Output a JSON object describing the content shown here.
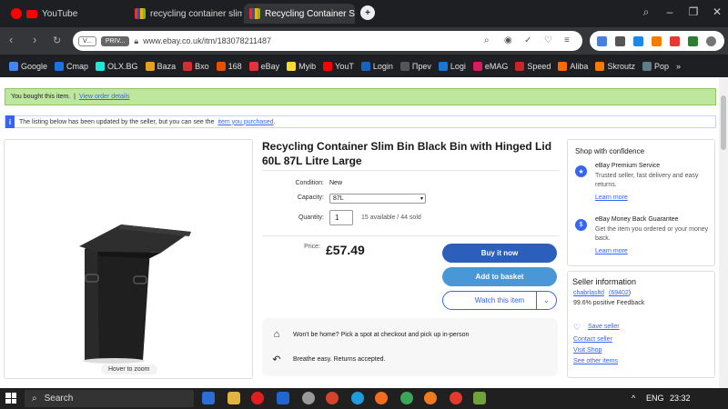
{
  "browser": {
    "tabs": [
      {
        "label": "YouTube",
        "color": "#ff0000"
      },
      {
        "label": "recycling container slim b",
        "color": "#e53238"
      },
      {
        "label": "Recycling Container Slim B",
        "color": "#e53238"
      }
    ],
    "new_tab": "+",
    "address": {
      "badge1": "V...",
      "badge2": "PRIV...",
      "url": "www.ebay.co.uk/itm/183078211487"
    }
  },
  "bookmarks": [
    {
      "label": "Google",
      "color": "#4285f4"
    },
    {
      "label": "Cmap",
      "color": "#1a73e8"
    },
    {
      "label": "OLX.BG",
      "color": "#23e5db"
    },
    {
      "label": "Baza",
      "color": "#e6a020"
    },
    {
      "label": "Bxo",
      "color": "#d32f2f"
    },
    {
      "label": "168",
      "color": "#e65100"
    },
    {
      "label": "eBay",
      "color": "#e53238"
    },
    {
      "label": "Myib",
      "color": "#fdd835"
    },
    {
      "label": "YouT",
      "color": "#ff0000"
    },
    {
      "label": "Login",
      "color": "#1565c0"
    },
    {
      "label": "Преv",
      "color": "#555555"
    },
    {
      "label": "Logi",
      "color": "#1976d2"
    },
    {
      "label": "eMAG",
      "color": "#d81b60"
    },
    {
      "label": "Speed",
      "color": "#c62828"
    },
    {
      "label": "Aliba",
      "color": "#ff6a00"
    },
    {
      "label": "Skroutz",
      "color": "#f57c00"
    },
    {
      "label": "Pop",
      "color": "#607d8b"
    },
    {
      "label": "»",
      "color": ""
    }
  ],
  "notices": {
    "bought": "You bought this item.",
    "sep": "|",
    "view_order": "View order details",
    "updated": "The listing below has been updated by the seller, but you can see the",
    "updated_link": "item you purchased",
    "updated_end": "."
  },
  "listing": {
    "title": "Recycling Container Slim Bin Black Bin with Hinged Lid 60L 87L Litre Large",
    "hover_zoom": "Hover to zoom",
    "condition_label": "Condition:",
    "condition_value": "New",
    "capacity_label": "Capacity:",
    "capacity_value": "87L",
    "quantity_label": "Quantity:",
    "quantity_value": "1",
    "availability": "15 available / 44 sold",
    "price_label": "Price:",
    "price": "£57.49",
    "buy_now": "Buy it now",
    "add_to_basket": "Add to basket",
    "watch": "Watch this item",
    "pickup": "Won't be home? Pick a spot at checkout and pick up in-person",
    "returns": "Breathe easy. Returns accepted."
  },
  "confidence": {
    "heading": "Shop with confidence",
    "premium_title": "eBay Premium Service",
    "premium_text": "Trusted seller, fast delivery and easy returns.",
    "premium_link": "Learn more",
    "mbg_title": "eBay Money Back Guarantee",
    "mbg_text": "Get the item you ordered or your money back.",
    "mbg_link": "Learn more"
  },
  "seller": {
    "heading": "Seller information",
    "name": "chabrlasltd",
    "feedback_count": "(69402",
    "feedback_close": ")",
    "positive": "99.6% positive Feedback",
    "save": "Save seller",
    "contact": "Contact seller",
    "visit": "Visit Shop",
    "other": "See other items"
  },
  "taskbar": {
    "search": "Search",
    "lang": "ENG",
    "time": "23:32"
  }
}
